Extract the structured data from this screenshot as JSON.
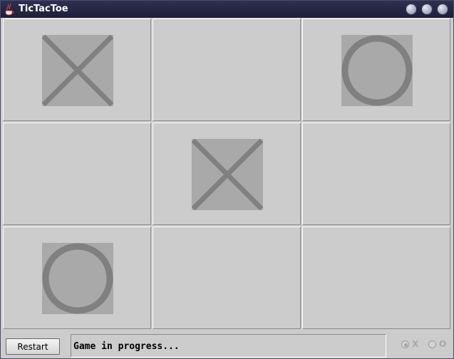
{
  "window": {
    "title": "TicTacToe",
    "icon": "java-cup-icon",
    "controls": [
      "minimize-icon",
      "maximize-icon",
      "close-icon"
    ]
  },
  "board": {
    "cells": [
      "X",
      "",
      "O",
      "",
      "X",
      "",
      "O",
      "",
      ""
    ]
  },
  "controls": {
    "restart_label": "Restart",
    "status_text": "Game in progress...",
    "turn_options": [
      {
        "label": "X",
        "selected": true,
        "enabled": false
      },
      {
        "label": "O",
        "selected": false,
        "enabled": false
      }
    ]
  },
  "colors": {
    "mark_background": "#a9a9a9",
    "mark_stroke": "#808080",
    "cell_background": "#cccccc",
    "titlebar": "#26264a"
  }
}
